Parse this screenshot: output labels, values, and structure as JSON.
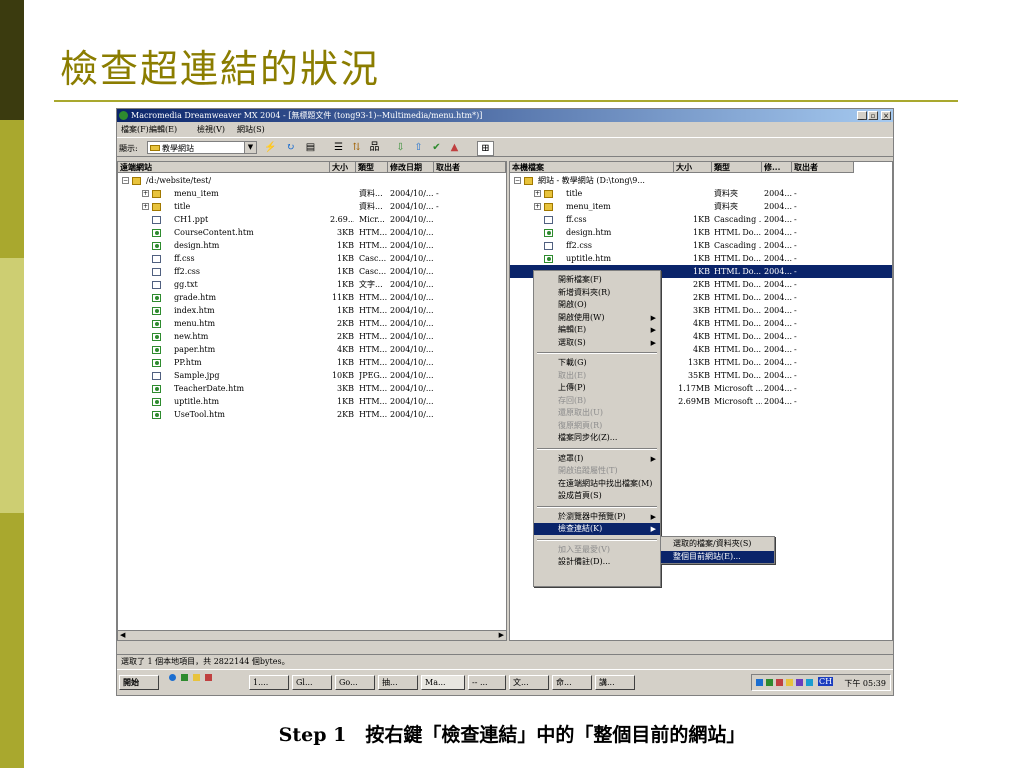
{
  "slide": {
    "title": "檢查超連結的狀況",
    "caption": "Step 1　按右鍵「檢查連結」中的「整個目前的網站」"
  },
  "window": {
    "title": "Macromedia Dreamweaver MX 2004 - [無標題文件 (tong93-1)--Multimedia/menu.htm*)]",
    "controls": [
      "_",
      "▫",
      "×"
    ],
    "menu": [
      "檔案(F)",
      "編輯(E)",
      "檢視(V)",
      "網站(S)"
    ],
    "toolbar": {
      "show_label": "顯示:",
      "site_select": "教學網站",
      "buttons": [
        "connect-icon",
        "refresh-icon",
        "view-icon",
        "expand-icon",
        "sync-icon",
        "site-map-icon",
        "get-icon",
        "put-icon",
        "checkout-icon",
        "checkin-icon",
        "expand-collapse-icon"
      ]
    }
  },
  "remote_pane": {
    "headers": [
      "遠端網站",
      "大小",
      "類型",
      "修改日期",
      "取出者"
    ],
    "root": "/d:/website/test/",
    "rows": [
      {
        "name": "menu_item",
        "size": "",
        "type": "資料...",
        "date": "2004/10/...",
        "by": "-",
        "icon": "folder",
        "expandable": true
      },
      {
        "name": "title",
        "size": "",
        "type": "資料...",
        "date": "2004/10/...",
        "by": "-",
        "icon": "folder",
        "expandable": true
      },
      {
        "name": "CH1.ppt",
        "size": "2.69...",
        "type": "Micr...",
        "date": "2004/10/...",
        "by": "",
        "icon": "file"
      },
      {
        "name": "CourseContent.htm",
        "size": "3KB",
        "type": "HTM...",
        "date": "2004/10/...",
        "by": "",
        "icon": "dw"
      },
      {
        "name": "design.htm",
        "size": "1KB",
        "type": "HTM...",
        "date": "2004/10/...",
        "by": "",
        "icon": "dw"
      },
      {
        "name": "ff.css",
        "size": "1KB",
        "type": "Casc...",
        "date": "2004/10/...",
        "by": "",
        "icon": "file"
      },
      {
        "name": "ff2.css",
        "size": "1KB",
        "type": "Casc...",
        "date": "2004/10/...",
        "by": "",
        "icon": "file"
      },
      {
        "name": "gg.txt",
        "size": "1KB",
        "type": "文字...",
        "date": "2004/10/...",
        "by": "",
        "icon": "file"
      },
      {
        "name": "grade.htm",
        "size": "11KB",
        "type": "HTM...",
        "date": "2004/10/...",
        "by": "",
        "icon": "dw"
      },
      {
        "name": "index.htm",
        "size": "1KB",
        "type": "HTM...",
        "date": "2004/10/...",
        "by": "",
        "icon": "dw"
      },
      {
        "name": "menu.htm",
        "size": "2KB",
        "type": "HTM...",
        "date": "2004/10/...",
        "by": "",
        "icon": "dw"
      },
      {
        "name": "new.htm",
        "size": "2KB",
        "type": "HTM...",
        "date": "2004/10/...",
        "by": "",
        "icon": "dw"
      },
      {
        "name": "paper.htm",
        "size": "4KB",
        "type": "HTM...",
        "date": "2004/10/...",
        "by": "",
        "icon": "dw"
      },
      {
        "name": "PP.htm",
        "size": "1KB",
        "type": "HTM...",
        "date": "2004/10/...",
        "by": "",
        "icon": "dw"
      },
      {
        "name": "Sample.jpg",
        "size": "10KB",
        "type": "JPEG...",
        "date": "2004/10/...",
        "by": "",
        "icon": "file"
      },
      {
        "name": "TeacherDate.htm",
        "size": "3KB",
        "type": "HTM...",
        "date": "2004/10/...",
        "by": "",
        "icon": "dw"
      },
      {
        "name": "uptitle.htm",
        "size": "1KB",
        "type": "HTM...",
        "date": "2004/10/...",
        "by": "",
        "icon": "dw"
      },
      {
        "name": "UseTool.htm",
        "size": "2KB",
        "type": "HTM...",
        "date": "2004/10/...",
        "by": "",
        "icon": "dw"
      }
    ]
  },
  "local_pane": {
    "headers": [
      "本機檔案",
      "大小",
      "類型",
      "修...",
      "取出者"
    ],
    "root": "網站 - 教學網站 (D:\\tong\\9...",
    "rows": [
      {
        "name": "title",
        "size": "",
        "type": "資料夾",
        "date": "2004...",
        "by": "-",
        "icon": "folder",
        "expandable": true
      },
      {
        "name": "menu_item",
        "size": "",
        "type": "資料夾",
        "date": "2004...",
        "by": "-",
        "icon": "folder",
        "expandable": true
      },
      {
        "name": "ff.css",
        "size": "1KB",
        "type": "Cascading ...",
        "date": "2004...",
        "by": "-",
        "icon": "file"
      },
      {
        "name": "design.htm",
        "size": "1KB",
        "type": "HTML Do...",
        "date": "2004...",
        "by": "-",
        "icon": "dw"
      },
      {
        "name": "ff2.css",
        "size": "1KB",
        "type": "Cascading ...",
        "date": "2004...",
        "by": "-",
        "icon": "file"
      },
      {
        "name": "uptitle.htm",
        "size": "1KB",
        "type": "HTML Do...",
        "date": "2004...",
        "by": "-",
        "icon": "dw"
      },
      {
        "name": "",
        "size": "1KB",
        "type": "HTML Do...",
        "date": "2004...",
        "by": "-",
        "icon": "dw",
        "selected": true
      },
      {
        "name": "",
        "size": "2KB",
        "type": "HTML Do...",
        "date": "2004...",
        "by": "-",
        "icon": "dw"
      },
      {
        "name": "",
        "size": "2KB",
        "type": "HTML Do...",
        "date": "2004...",
        "by": "-",
        "icon": "dw"
      },
      {
        "name": "",
        "size": "3KB",
        "type": "HTML Do...",
        "date": "2004...",
        "by": "-",
        "icon": "dw"
      },
      {
        "name": "",
        "size": "4KB",
        "type": "HTML Do...",
        "date": "2004...",
        "by": "-",
        "icon": "dw"
      },
      {
        "name": "",
        "size": "4KB",
        "type": "HTML Do...",
        "date": "2004...",
        "by": "-",
        "icon": "dw"
      },
      {
        "name": "",
        "size": "4KB",
        "type": "HTML Do...",
        "date": "2004...",
        "by": "-",
        "icon": "dw"
      },
      {
        "name": "",
        "size": "13KB",
        "type": "HTML Do...",
        "date": "2004...",
        "by": "-",
        "icon": "dw"
      },
      {
        "name": "",
        "size": "35KB",
        "type": "HTML Do...",
        "date": "2004...",
        "by": "-",
        "icon": "dw"
      },
      {
        "name": "",
        "size": "1.17MB",
        "type": "Microsoft ...",
        "date": "2004...",
        "by": "-",
        "icon": "file"
      },
      {
        "name": "",
        "size": "2.69MB",
        "type": "Microsoft ...",
        "date": "2004...",
        "by": "-",
        "icon": "file"
      }
    ]
  },
  "context_menu": [
    {
      "label": "開新檔案(F)",
      "disabled": false
    },
    {
      "label": "新增資料夾(R)",
      "disabled": false
    },
    {
      "label": "開啟(O)",
      "disabled": false
    },
    {
      "label": "開啟使用(W)",
      "disabled": false,
      "submenu": true
    },
    {
      "label": "編輯(E)",
      "disabled": false,
      "submenu": true
    },
    {
      "label": "選取(S)",
      "disabled": false,
      "submenu": true
    },
    {
      "sep": true
    },
    {
      "label": "下載(G)",
      "disabled": false
    },
    {
      "label": "取出(E)",
      "disabled": true
    },
    {
      "label": "上傳(P)",
      "disabled": false
    },
    {
      "label": "存回(B)",
      "disabled": true
    },
    {
      "label": "還原取出(U)",
      "disabled": true
    },
    {
      "label": "復原網頁(R)",
      "disabled": true
    },
    {
      "label": "檔案同步化(Z)...",
      "disabled": false
    },
    {
      "sep": true
    },
    {
      "label": "遮罩(I)",
      "disabled": false,
      "submenu": true
    },
    {
      "label": "開啟追蹤屬性(T)",
      "disabled": true
    },
    {
      "label": "在遠端網站中找出檔案(M)",
      "disabled": false
    },
    {
      "label": "設成首頁(S)",
      "disabled": false
    },
    {
      "sep": true
    },
    {
      "label": "於瀏覽器中預覽(P)",
      "disabled": false,
      "submenu": true
    },
    {
      "label": "檢查連結(K)",
      "disabled": false,
      "submenu": true,
      "highlighted": true
    },
    {
      "sep": true
    },
    {
      "label": "加入至最愛(V)",
      "disabled": true
    },
    {
      "label": "設計備註(D)...",
      "disabled": false
    }
  ],
  "submenu": [
    {
      "label": "選取的檔案/資料夾(S)",
      "highlighted": false
    },
    {
      "label": "整個目前網站(E)...",
      "highlighted": true
    }
  ],
  "statusbar": "選取了 1 個本地項目，共 2822144 個bytes。",
  "taskbar": {
    "start": "開始",
    "items": [
      "1....",
      "Gl...",
      "Go...",
      "抽...",
      "Ma...",
      "-- ...",
      "文...",
      "命...",
      "講..."
    ],
    "clock": "下午 05:39",
    "tray_label": "CH"
  }
}
